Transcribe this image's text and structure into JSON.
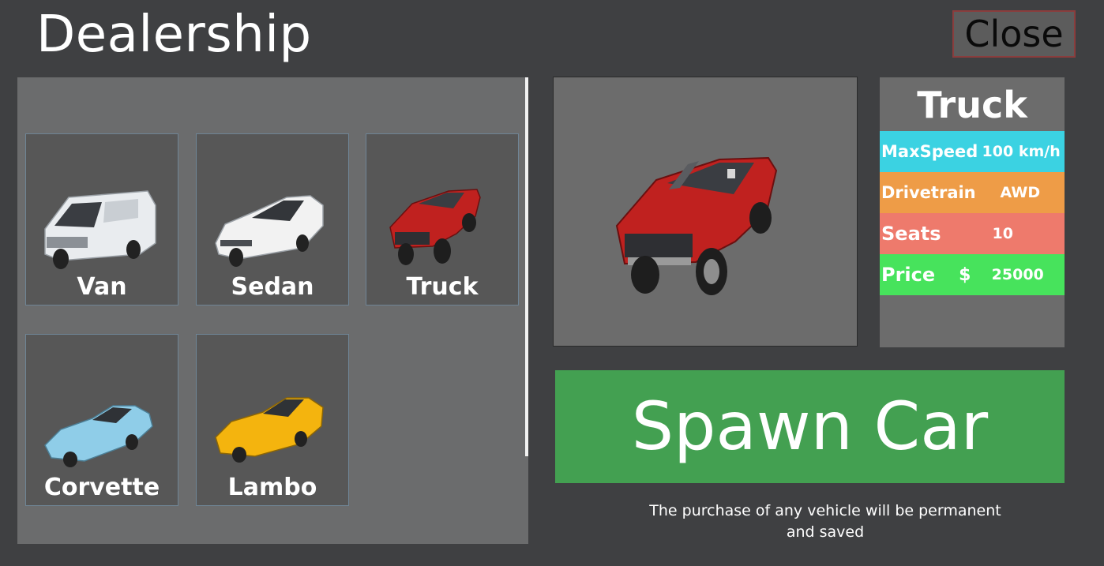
{
  "header": {
    "title": "Dealership",
    "close_label": "Close"
  },
  "vehicles": [
    {
      "name": "Van",
      "color": "#e9ecef"
    },
    {
      "name": "Sedan",
      "color": "#f2f2f2"
    },
    {
      "name": "Truck",
      "color": "#c0211f"
    },
    {
      "name": "Corvette",
      "color": "#8fcde8"
    },
    {
      "name": "Lambo",
      "color": "#f4b40e"
    }
  ],
  "selected": {
    "name": "Truck",
    "color": "#c0211f",
    "stats": [
      {
        "label": "MaxSpeed",
        "value": "100 km/h",
        "color": "#3bd2e2"
      },
      {
        "label": "Drivetrain",
        "value": "AWD",
        "color": "#ee9c47"
      },
      {
        "label": "Seats",
        "value": "10",
        "color": "#ee7a6c"
      },
      {
        "label": "Price",
        "currency": "$",
        "value": "25000",
        "color": "#47e35c"
      }
    ]
  },
  "spawn_label": "Spawn Car",
  "notice": "The purchase of any vehicle will be permanent and saved"
}
